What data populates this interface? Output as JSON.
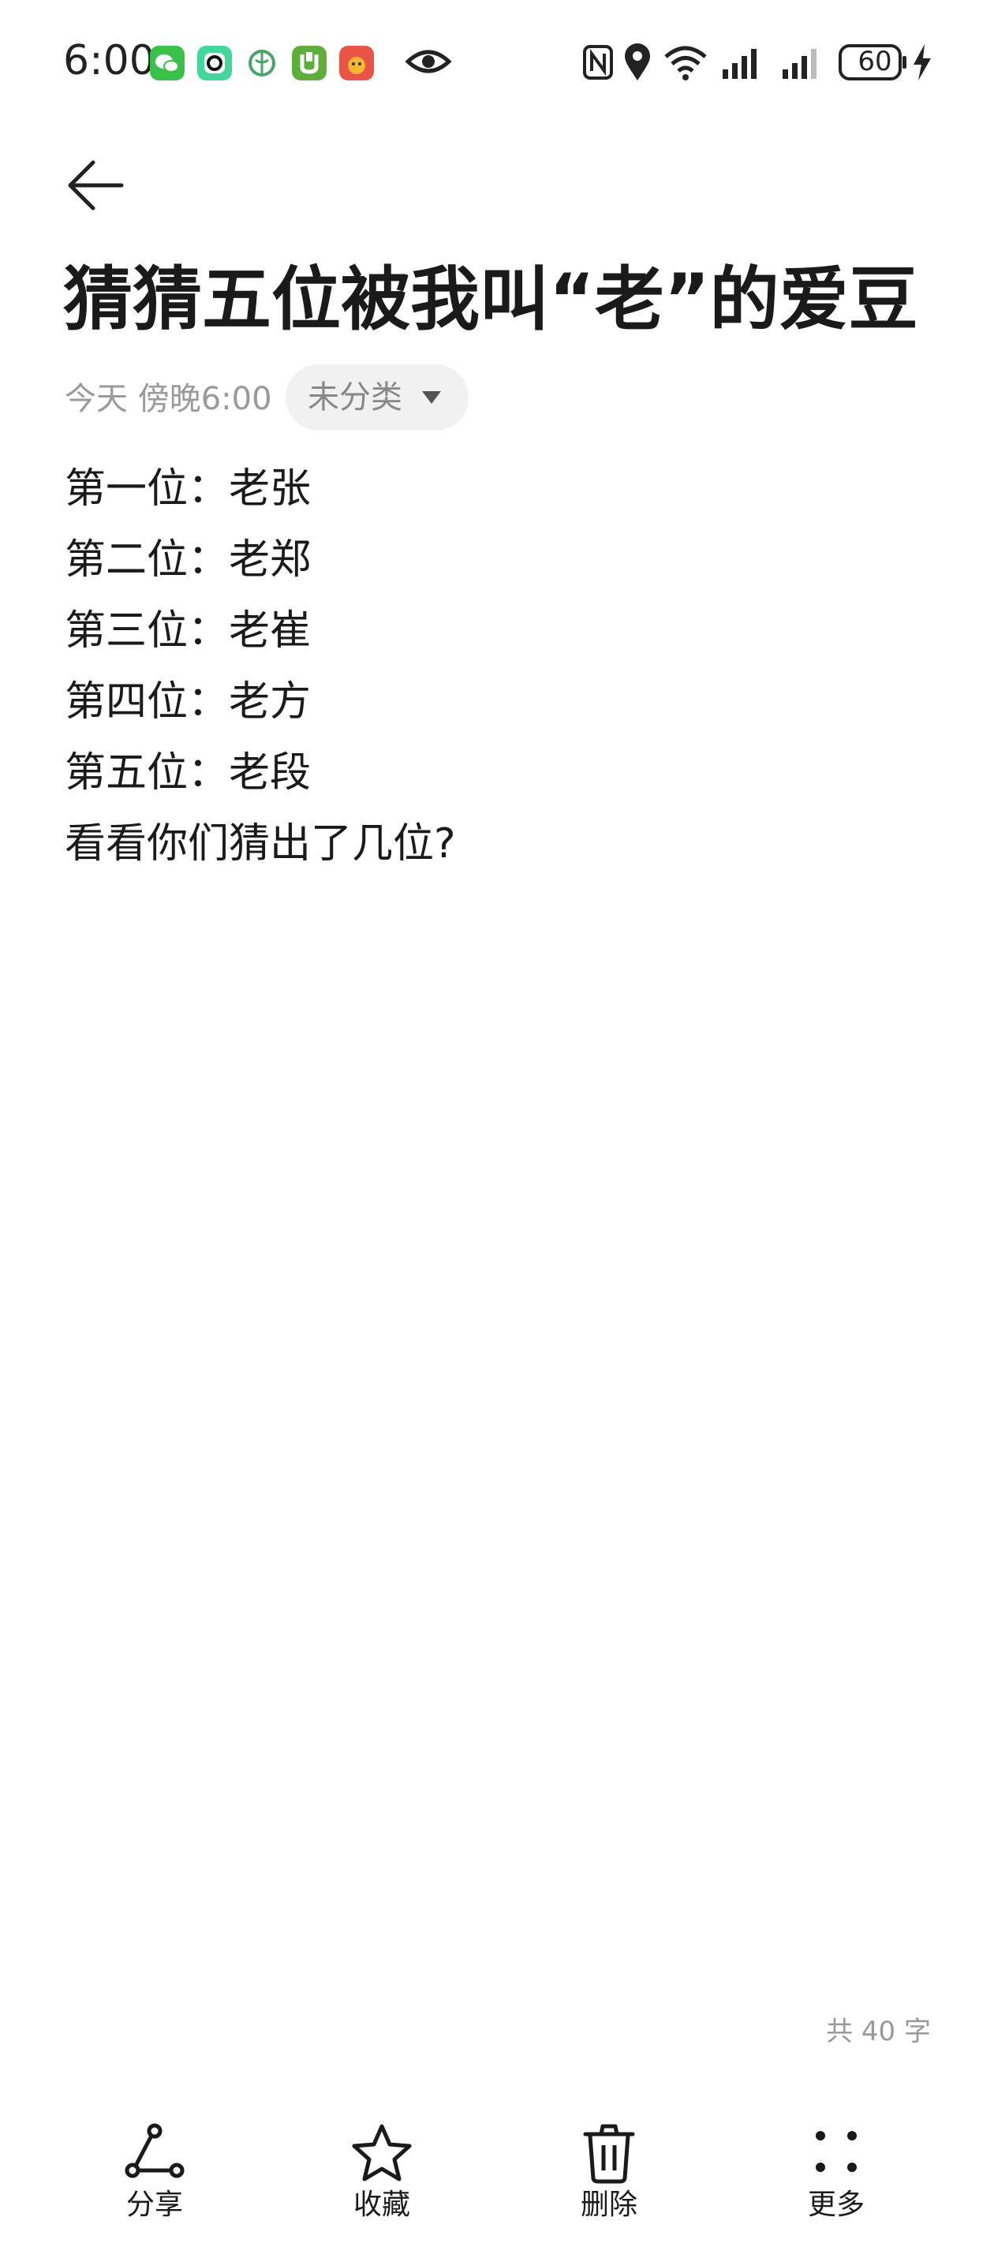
{
  "status_bar": {
    "time": "6:00",
    "battery": "60",
    "app_icons": [
      "wechat-icon",
      "camera-app-icon",
      "browser-app-icon",
      "u-app-icon",
      "shopping-app-icon"
    ],
    "indicators": [
      "eye-icon",
      "nfc-icon",
      "location-icon",
      "wifi-icon",
      "signal-icon",
      "signal-icon-2",
      "battery-icon",
      "charging-icon"
    ]
  },
  "note": {
    "title": "猜猜五位被我叫“老”的爱豆",
    "date": "今天 傍晚6:00",
    "category": "未分类",
    "lines": [
      "第一位：老张",
      "第二位：老郑",
      "第三位：老崔",
      "第四位：老方",
      "第五位：老段",
      "看看你们猜出了几位?"
    ],
    "word_count": "共 40 字"
  },
  "toolbar": {
    "share": "分享",
    "favorite": "收藏",
    "delete": "删除",
    "more": "更多"
  },
  "colors": {
    "background": "#ffffff",
    "text": "#1a1a1a",
    "muted": "#9a9a9a",
    "pill_bg": "#f1f1f1"
  }
}
